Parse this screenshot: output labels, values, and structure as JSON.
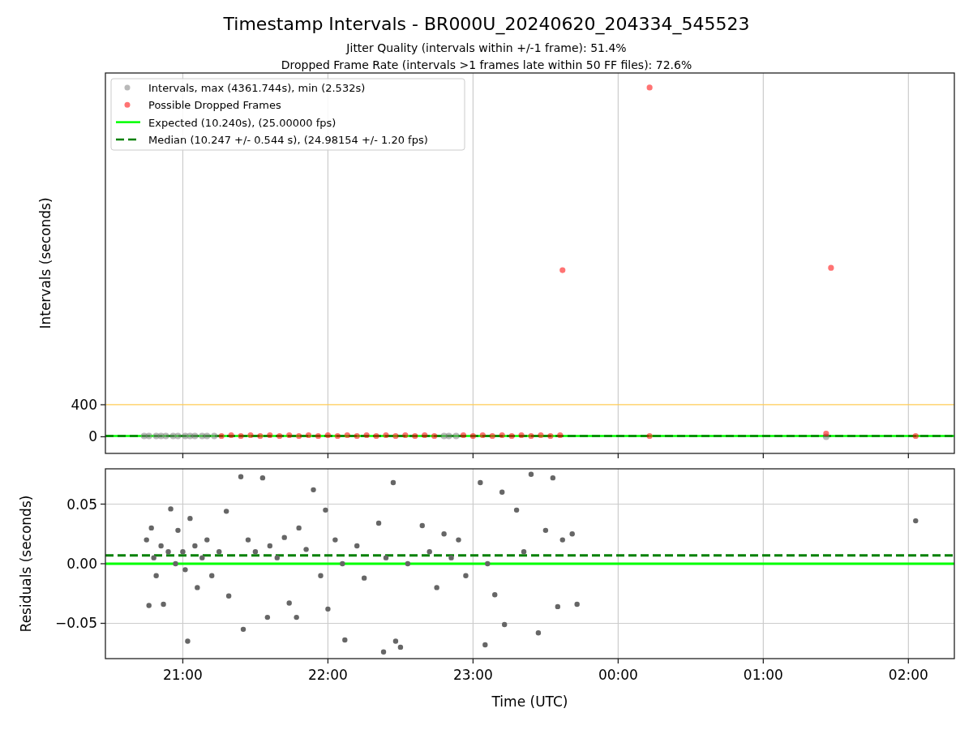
{
  "figure": {
    "title": "Timestamp Intervals - BR000U_20240620_204334_545523",
    "subtitles": [
      "Jitter Quality (intervals within +/-1 frame): 51.4%",
      "Dropped Frame Rate (intervals >1 frames late within 50 FF files): 72.6%"
    ]
  },
  "intervals_plot": {
    "chart_data": {
      "type": "scatter",
      "ylabel": "Intervals (seconds)",
      "grid": true,
      "legend": true,
      "xlim": [
        "2024-06-20T20:28",
        "2024-06-21T02:19"
      ],
      "ylim": [
        -208,
        4542
      ],
      "yticks": [
        {
          "value": 0,
          "label": "0"
        },
        {
          "value": 400,
          "label": "400"
        }
      ],
      "series": [
        {
          "name": "Intervals, max (4361.744s), min (2.532s)",
          "color": "#808080",
          "x": [
            "2024-06-20T20:44",
            "2024-06-20T20:46",
            "2024-06-20T20:49",
            "2024-06-20T20:51",
            "2024-06-20T20:53",
            "2024-06-20T20:56",
            "2024-06-20T20:58",
            "2024-06-20T21:01",
            "2024-06-20T21:03",
            "2024-06-20T21:05",
            "2024-06-20T21:08",
            "2024-06-20T21:10",
            "2024-06-20T21:13",
            "2024-06-20T22:48",
            "2024-06-20T22:50",
            "2024-06-20T22:53",
            "2024-06-21T01:26"
          ],
          "values": [
            10,
            10,
            10,
            10,
            10,
            10,
            10,
            10,
            10,
            10,
            10,
            10,
            10,
            10,
            10,
            10,
            0
          ]
        },
        {
          "name": "Possible Dropped Frames",
          "color": "#ff0000",
          "x": [
            "2024-06-20T21:16",
            "2024-06-20T21:20",
            "2024-06-20T21:24",
            "2024-06-20T21:28",
            "2024-06-20T21:32",
            "2024-06-20T21:36",
            "2024-06-20T21:40",
            "2024-06-20T21:44",
            "2024-06-20T21:48",
            "2024-06-20T21:52",
            "2024-06-20T21:56",
            "2024-06-20T22:00",
            "2024-06-20T22:04",
            "2024-06-20T22:08",
            "2024-06-20T22:12",
            "2024-06-20T22:16",
            "2024-06-20T22:20",
            "2024-06-20T22:24",
            "2024-06-20T22:28",
            "2024-06-20T22:32",
            "2024-06-20T22:36",
            "2024-06-20T22:40",
            "2024-06-20T22:44",
            "2024-06-20T22:56",
            "2024-06-20T23:00",
            "2024-06-20T23:04",
            "2024-06-20T23:08",
            "2024-06-20T23:12",
            "2024-06-20T23:16",
            "2024-06-20T23:20",
            "2024-06-20T23:24",
            "2024-06-20T23:28",
            "2024-06-20T23:32",
            "2024-06-20T23:36",
            "2024-06-20T23:37",
            "2024-06-21T00:13",
            "2024-06-21T00:13",
            "2024-06-21T01:26",
            "2024-06-21T01:28",
            "2024-06-21T02:03"
          ],
          "values": [
            10,
            20,
            10,
            20,
            10,
            20,
            10,
            20,
            10,
            20,
            10,
            20,
            10,
            20,
            10,
            20,
            10,
            20,
            10,
            20,
            10,
            20,
            10,
            20,
            10,
            20,
            10,
            20,
            10,
            20,
            10,
            20,
            10,
            20,
            2080,
            10,
            4360,
            40,
            2110,
            10
          ]
        }
      ],
      "ref_lines": [
        {
          "axis": "y",
          "value": 10.24,
          "label": "Expected (10.240s), (25.00000 fps)",
          "color": "#00ff00"
        },
        {
          "axis": "y",
          "value": 10.247,
          "label": "Median (10.247 +/- 0.544 s), (24.98154 +/- 1.20 fps)",
          "color": "#008000"
        },
        {
          "axis": "y",
          "value": 400,
          "color": "#ffcc55"
        }
      ]
    }
  },
  "residuals_plot": {
    "chart_data": {
      "type": "scatter",
      "xlabel": "Time (UTC)",
      "ylabel": "Residuals (seconds)",
      "grid": true,
      "xlim": [
        "2024-06-20T20:28",
        "2024-06-21T02:19"
      ],
      "ylim": [
        -0.0796,
        0.0796
      ],
      "xticks": [
        {
          "value": "2024-06-20T21:00",
          "label": "21:00"
        },
        {
          "value": "2024-06-20T22:00",
          "label": "22:00"
        },
        {
          "value": "2024-06-20T23:00",
          "label": "23:00"
        },
        {
          "value": "2024-06-21T00:00",
          "label": "00:00"
        },
        {
          "value": "2024-06-21T01:00",
          "label": "01:00"
        },
        {
          "value": "2024-06-21T02:00",
          "label": "02:00"
        }
      ],
      "yticks": [
        {
          "value": -0.05,
          "label": "−0.05"
        },
        {
          "value": 0,
          "label": "0.00"
        },
        {
          "value": 0.05,
          "label": "0.05"
        }
      ],
      "series": [
        {
          "color": "#666666",
          "x": [
            "2024-06-20T20:45",
            "2024-06-20T20:46",
            "2024-06-20T20:47",
            "2024-06-20T20:48",
            "2024-06-20T20:49",
            "2024-06-20T20:51",
            "2024-06-20T20:52",
            "2024-06-20T20:54",
            "2024-06-20T20:55",
            "2024-06-20T20:57",
            "2024-06-20T20:58",
            "2024-06-20T21:00",
            "2024-06-20T21:01",
            "2024-06-20T21:02",
            "2024-06-20T21:03",
            "2024-06-20T21:05",
            "2024-06-20T21:06",
            "2024-06-20T21:08",
            "2024-06-20T21:10",
            "2024-06-20T21:12",
            "2024-06-20T21:15",
            "2024-06-20T21:18",
            "2024-06-20T21:19",
            "2024-06-20T21:24",
            "2024-06-20T21:25",
            "2024-06-20T21:27",
            "2024-06-20T21:30",
            "2024-06-20T21:33",
            "2024-06-20T21:35",
            "2024-06-20T21:36",
            "2024-06-20T21:39",
            "2024-06-20T21:42",
            "2024-06-20T21:44",
            "2024-06-20T21:47",
            "2024-06-20T21:48",
            "2024-06-20T21:51",
            "2024-06-20T21:54",
            "2024-06-20T21:57",
            "2024-06-20T21:59",
            "2024-06-20T22:00",
            "2024-06-20T22:03",
            "2024-06-20T22:06",
            "2024-06-20T22:07",
            "2024-06-20T22:12",
            "2024-06-20T22:15",
            "2024-06-20T22:21",
            "2024-06-20T22:23",
            "2024-06-20T22:24",
            "2024-06-20T22:27",
            "2024-06-20T22:28",
            "2024-06-20T22:30",
            "2024-06-20T22:33",
            "2024-06-20T22:39",
            "2024-06-20T22:42",
            "2024-06-20T22:45",
            "2024-06-20T22:48",
            "2024-06-20T22:51",
            "2024-06-20T22:54",
            "2024-06-20T22:57",
            "2024-06-20T23:03",
            "2024-06-20T23:05",
            "2024-06-20T23:06",
            "2024-06-20T23:09",
            "2024-06-20T23:12",
            "2024-06-20T23:13",
            "2024-06-20T23:18",
            "2024-06-20T23:21",
            "2024-06-20T23:24",
            "2024-06-20T23:27",
            "2024-06-20T23:30",
            "2024-06-20T23:33",
            "2024-06-20T23:35",
            "2024-06-20T23:37",
            "2024-06-20T23:41",
            "2024-06-20T23:43",
            "2024-06-21T02:03"
          ],
          "values": [
            0.02,
            -0.035,
            0.03,
            0.005,
            -0.01,
            0.015,
            -0.034,
            0.01,
            0.046,
            0.0,
            0.028,
            0.01,
            -0.005,
            -0.065,
            0.038,
            0.015,
            -0.02,
            0.005,
            0.02,
            -0.01,
            0.01,
            0.044,
            -0.027,
            0.073,
            -0.055,
            0.02,
            0.01,
            0.072,
            -0.045,
            0.015,
            0.005,
            0.022,
            -0.033,
            -0.045,
            0.03,
            0.012,
            0.062,
            -0.01,
            0.045,
            -0.038,
            0.02,
            0.0,
            -0.064,
            0.015,
            -0.012,
            0.034,
            -0.074,
            0.005,
            0.068,
            -0.065,
            -0.07,
            0.0,
            0.032,
            0.01,
            -0.02,
            0.025,
            0.005,
            0.02,
            -0.01,
            0.068,
            -0.068,
            0.0,
            -0.026,
            0.06,
            -0.051,
            0.045,
            0.01,
            0.075,
            -0.058,
            0.028,
            0.072,
            -0.036,
            0.02,
            0.025,
            -0.034,
            0.036
          ]
        }
      ],
      "ref_lines": [
        {
          "axis": "y",
          "value": 0.007,
          "color": "#008000"
        },
        {
          "axis": "y",
          "value": 0,
          "color": "#00ff00"
        }
      ]
    }
  }
}
